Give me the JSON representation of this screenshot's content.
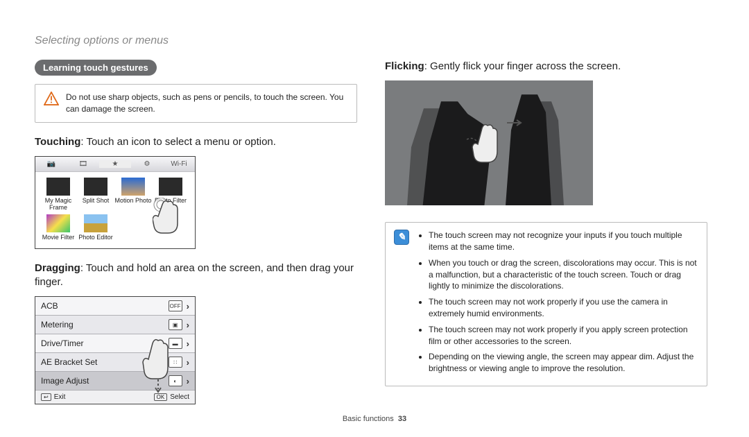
{
  "page_heading": "Selecting options or menus",
  "left": {
    "pill": "Learning touch gestures",
    "warning": "Do not use sharp objects, such as pens or pencils, to touch the screen. You can damage the screen.",
    "touching_label": "Touching",
    "touching_desc": ": Touch an icon to select a menu or option.",
    "grid": {
      "wifi_tab": "Wi-Fi",
      "items": [
        {
          "name": "My Magic Frame"
        },
        {
          "name": "Split Shot"
        },
        {
          "name": "Motion Photo"
        },
        {
          "name": "Photo Filter"
        },
        {
          "name": "Movie Filter"
        },
        {
          "name": "Photo Editor"
        }
      ]
    },
    "dragging_label": "Dragging",
    "dragging_desc": ": Touch and hold an area on the screen, and then drag your finger.",
    "list": {
      "rows": [
        {
          "label": "ACB",
          "glyph": "OFF"
        },
        {
          "label": "Metering",
          "glyph": "▣"
        },
        {
          "label": "Drive/Timer",
          "glyph": "▬"
        },
        {
          "label": "AE Bracket Set",
          "glyph": "∷"
        },
        {
          "label": "Image Adjust",
          "glyph": "◐"
        }
      ],
      "exit_key": "↩",
      "exit_label": "Exit",
      "select_key": "OK",
      "select_label": "Select"
    }
  },
  "right": {
    "flicking_label": "Flicking",
    "flicking_desc": ": Gently flick your finger across the screen.",
    "notes": [
      "The touch screen may not recognize your inputs if you touch multiple items at the same time.",
      "When you touch or drag the screen, discolorations may occur. This is not a malfunction, but a characteristic of the touch screen. Touch or drag lightly to minimize the discolorations.",
      "The touch screen may not work properly if you use the camera in extremely humid environments.",
      "The touch screen may not work properly if you apply screen protection film or other accessories to the screen.",
      "Depending on the viewing angle, the screen may appear dim. Adjust the brightness or viewing angle to improve the resolution."
    ]
  },
  "footer": {
    "section": "Basic functions",
    "page": "33"
  }
}
